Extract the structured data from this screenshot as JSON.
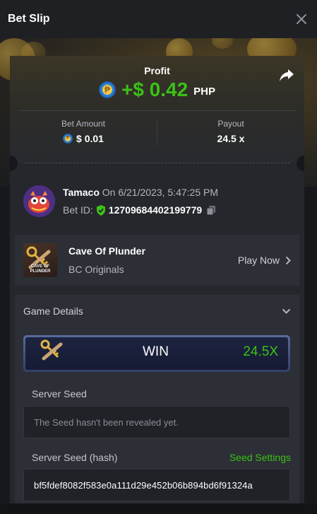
{
  "header": {
    "title": "Bet Slip"
  },
  "profit": {
    "label": "Profit",
    "value": "+$ 0.42",
    "currency": "PHP",
    "coin_symbol": "₱"
  },
  "stats": {
    "bet_amount_label": "Bet Amount",
    "bet_amount_value": "$ 0.01",
    "payout_label": "Payout",
    "payout_value": "24.5 x"
  },
  "player": {
    "name": "Tamaco",
    "date_text": "On 6/21/2023, 5:47:25 PM",
    "bet_id_label": "Bet ID:",
    "bet_id": "12709684402199779"
  },
  "game": {
    "name": "Cave Of Plunder",
    "provider": "BC Originals",
    "play_now_label": "Play Now",
    "thumb_text": "CAVE OF PLUNDER"
  },
  "details": {
    "title": "Game Details",
    "result_label": "WIN",
    "result_multiplier": "24.5X",
    "server_seed_label": "Server Seed",
    "server_seed_value": "The Seed hasn't been revealed yet.",
    "server_seed_hash_label": "Server Seed (hash)",
    "seed_settings_label": "Seed Settings",
    "server_seed_hash_value": "bf5fdef8082f583e0a111d29e452b06b894bd6f91324a"
  },
  "colors": {
    "accent_green": "#3bc117",
    "card_bg": "#25272c",
    "panel_bg": "#2c2f35"
  }
}
